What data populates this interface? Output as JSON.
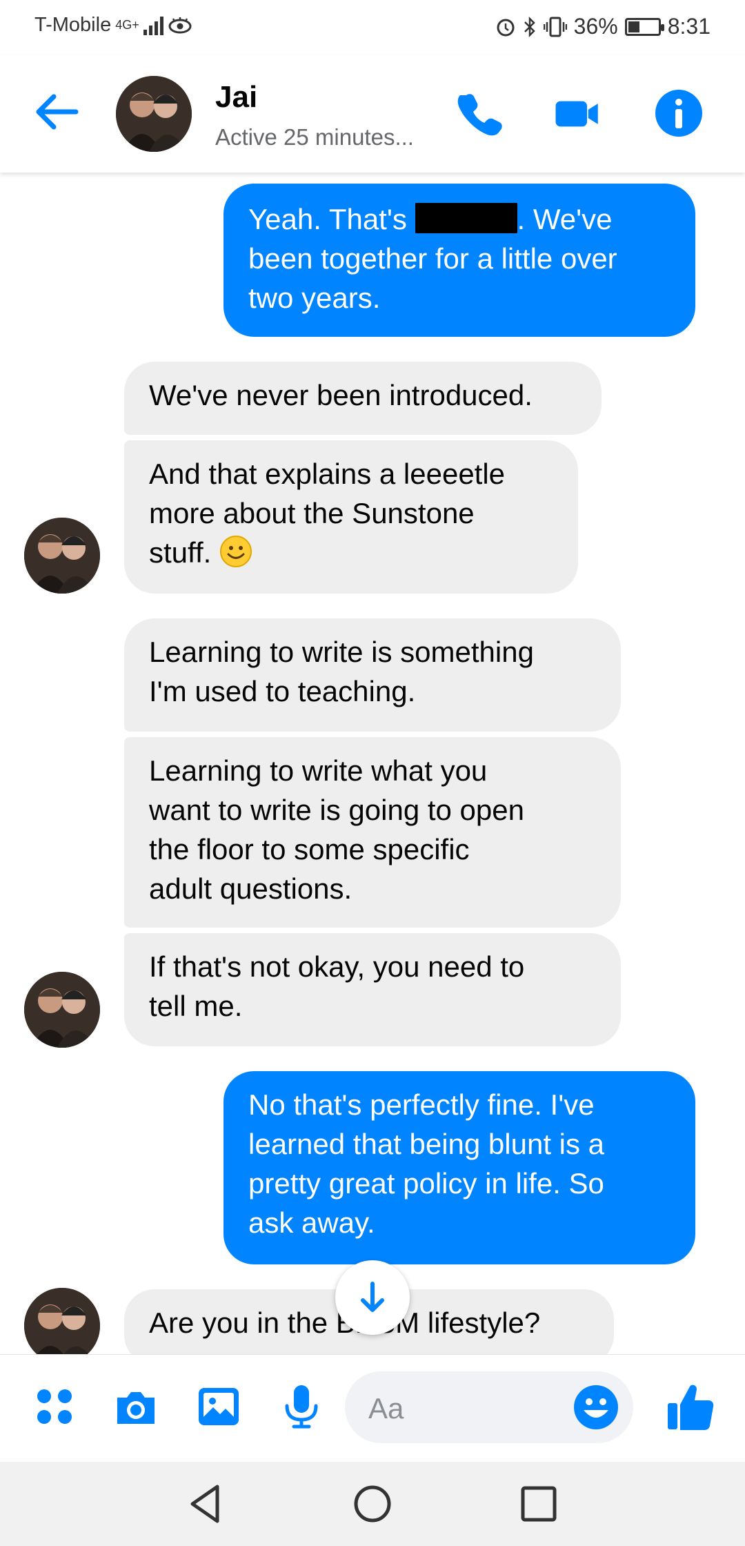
{
  "status_bar": {
    "carrier": "T-Mobile",
    "network": "4G+",
    "battery": "36%",
    "battery_level": 0.36,
    "time": "8:31"
  },
  "header": {
    "name": "Jai",
    "status": "Active 25 minutes..."
  },
  "messages": [
    {
      "dir": "out",
      "lines": [
        "Yeah. That's ",
        ". We've",
        "been together for a little over",
        "two years."
      ]
    },
    {
      "dir": "in",
      "lines": [
        "We've never been introduced."
      ]
    },
    {
      "dir": "in",
      "lines": [
        "And that explains a leeeetle",
        "more about the Sunstone",
        "stuff. "
      ]
    },
    {
      "dir": "in",
      "lines": [
        "Learning to write is something",
        "I'm used to teaching."
      ]
    },
    {
      "dir": "in",
      "lines": [
        "Learning to write what you",
        "want to write is going to open",
        "the floor to some specific",
        "adult questions."
      ]
    },
    {
      "dir": "in",
      "lines": [
        "If that's not okay, you need to",
        "tell me."
      ]
    },
    {
      "dir": "out",
      "lines": [
        "No that's perfectly fine. I've",
        "learned that being blunt is a",
        "pretty great policy in life. So",
        "ask away."
      ]
    },
    {
      "dir": "in",
      "lines": [
        "Are you in the BDSM lifestyle?"
      ]
    }
  ],
  "composer": {
    "placeholder": "Aa"
  },
  "colors": {
    "accent": "#0084ff",
    "incoming": "#eeeeee"
  }
}
